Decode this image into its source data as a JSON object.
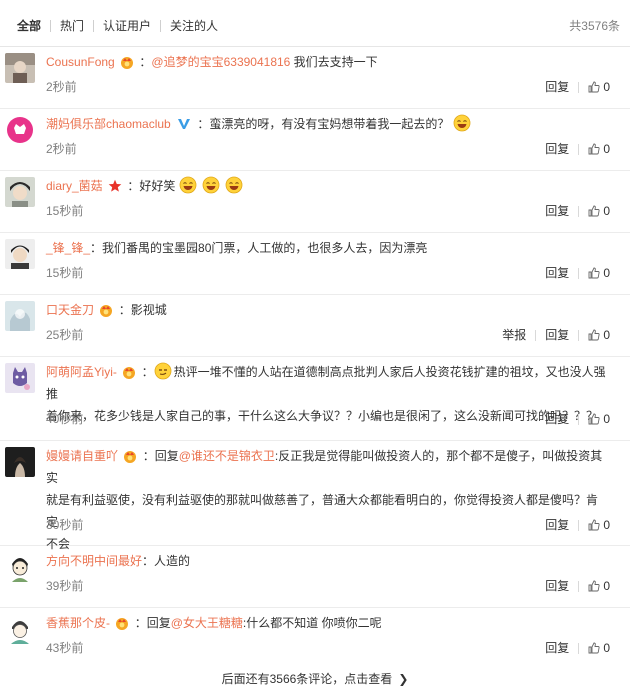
{
  "tabs": [
    "全部",
    "热门",
    "认证用户",
    "关注的人"
  ],
  "total": "共3576条",
  "actions": {
    "report": "举报",
    "reply": "回复"
  },
  "comments": [
    {
      "user": "CousunFong",
      "sep": "：",
      "at": "@追梦的宝宝6339041816",
      "text": " 我们去支持一下",
      "time": "2秒前",
      "likes": "0"
    },
    {
      "user": "潮妈俱乐部chaomaclub",
      "sep": "：",
      "text": "蛮漂亮的呀，有没有宝妈想带着我一起去的？",
      "time": "2秒前",
      "likes": "0"
    },
    {
      "user": "diary_菌菇",
      "sep": "：",
      "text": "好好笑",
      "time": "15秒前",
      "likes": "0"
    },
    {
      "user": "_锋_锋_",
      "sep": "：",
      "text": "我们番禺的宝墨园80门票，人工做的，也很多人去，因为漂亮",
      "time": "15秒前",
      "likes": "0"
    },
    {
      "user": "口天金刀",
      "sep": "：",
      "text": "影视城",
      "time": "25秒前",
      "likes": "0"
    },
    {
      "user": "阿萌阿孟Yiyi-",
      "sep": "：",
      "text_line1": "热评一堆不懂的人站在道德制高点批判人家后人投资花钱扩建的祖坟，又也没人强推",
      "text_line2": "着你来，花多少钱是人家自己的事，干什么这么大争议？？小编也是很闲了，这么没新闻可找的吗？？？",
      "time": "40秒前",
      "likes": "0"
    },
    {
      "user": "嫚嫚请自重吖",
      "sep": "：",
      "reply_prefix": "回复",
      "at": "@谁还不是锦衣卫",
      "text_line1": ":反正我是觉得能叫做投资人的，那个都不是傻子，叫做投资其实",
      "text_line2": "就是有利益驱使，没有利益驱使的那就叫做慈善了，普通大众都能看明白的，你觉得投资人都是傻吗？肯定",
      "text_line3": "不会",
      "time": "30秒前",
      "likes": "0"
    },
    {
      "user": "方向不明中间最好",
      "sep": "：",
      "text": "人造的",
      "time": "39秒前",
      "likes": "0"
    },
    {
      "user": "香蕉那个皮-",
      "sep": "：",
      "reply_prefix": "回复",
      "at": "@女大王糖糖",
      "text": ":什么都不知道 你喷你二呢",
      "time": "43秒前",
      "likes": "0"
    }
  ],
  "footer": {
    "text": "后面还有3566条评论，点击查看"
  },
  "colors": {
    "username": "#eb7350",
    "time": "#808080",
    "border": "#ececec"
  }
}
